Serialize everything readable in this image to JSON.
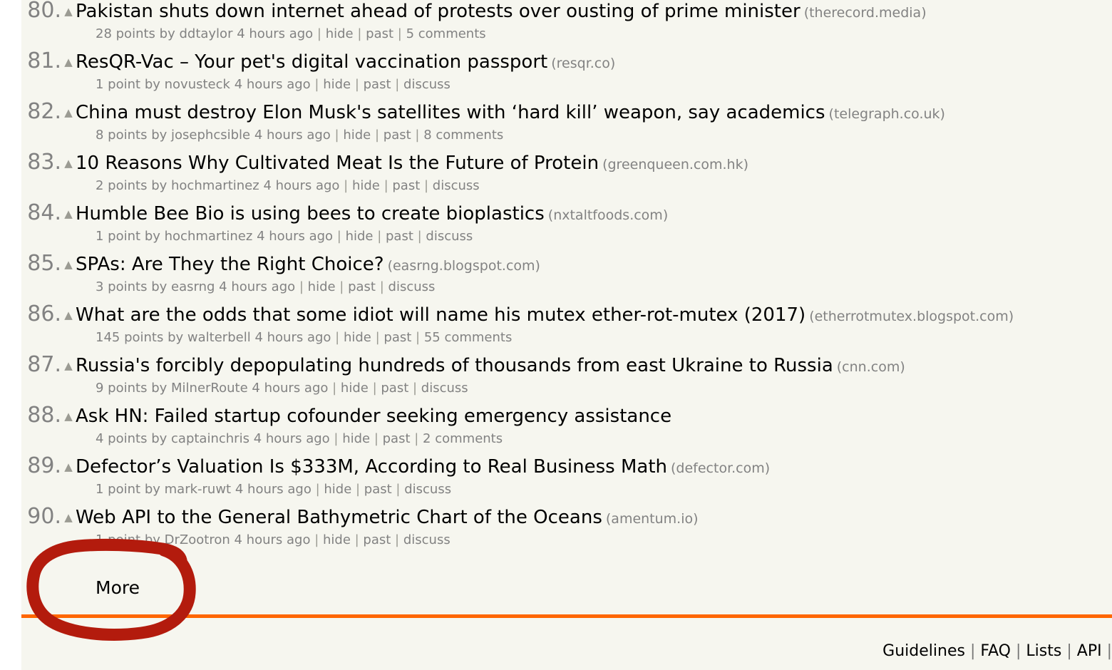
{
  "site": {
    "background": "#f6f6ef",
    "page_background": "#ffffff",
    "accent": "#ff6600",
    "muted_text": "#828282",
    "annotation_color": "#b31b0d"
  },
  "stories": [
    {
      "rank": "80.",
      "upvote_icon": "triangle-up-icon",
      "title": "Pakistan shuts down internet ahead of protests over ousting of prime minister",
      "site": "(therecord.media)",
      "points": "28 points",
      "by_label": "by",
      "author": "ddtaylor",
      "age": "4 hours ago",
      "hide": "hide",
      "past": "past",
      "comments": "5 comments"
    },
    {
      "rank": "81.",
      "upvote_icon": "triangle-up-icon",
      "title": "ResQR-Vac – Your pet's digital vaccination passport",
      "site": "(resqr.co)",
      "points": "1 point",
      "by_label": "by",
      "author": "novusteck",
      "age": "4 hours ago",
      "hide": "hide",
      "past": "past",
      "comments": "discuss"
    },
    {
      "rank": "82.",
      "upvote_icon": "triangle-up-icon",
      "title": "China must destroy Elon Musk's satellites with ‘hard kill’ weapon, say academics",
      "site": "(telegraph.co.uk)",
      "points": "8 points",
      "by_label": "by",
      "author": "josephcsible",
      "age": "4 hours ago",
      "hide": "hide",
      "past": "past",
      "comments": "8 comments"
    },
    {
      "rank": "83.",
      "upvote_icon": "triangle-up-icon",
      "title": "10 Reasons Why Cultivated Meat Is the Future of Protein",
      "site": "(greenqueen.com.hk)",
      "points": "2 points",
      "by_label": "by",
      "author": "hochmartinez",
      "age": "4 hours ago",
      "hide": "hide",
      "past": "past",
      "comments": "discuss"
    },
    {
      "rank": "84.",
      "upvote_icon": "triangle-up-icon",
      "title": "Humble Bee Bio is using bees to create bioplastics",
      "site": "(nxtaltfoods.com)",
      "points": "1 point",
      "by_label": "by",
      "author": "hochmartinez",
      "age": "4 hours ago",
      "hide": "hide",
      "past": "past",
      "comments": "discuss"
    },
    {
      "rank": "85.",
      "upvote_icon": "triangle-up-icon",
      "title": "SPAs: Are They the Right Choice?",
      "site": "(easrng.blogspot.com)",
      "points": "3 points",
      "by_label": "by",
      "author": "easrng",
      "age": "4 hours ago",
      "hide": "hide",
      "past": "past",
      "comments": "discuss"
    },
    {
      "rank": "86.",
      "upvote_icon": "triangle-up-icon",
      "title": "What are the odds that some idiot will name his mutex ether-rot-mutex (2017)",
      "site": "(etherrotmutex.blogspot.com)",
      "points": "145 points",
      "by_label": "by",
      "author": "walterbell",
      "age": "4 hours ago",
      "hide": "hide",
      "past": "past",
      "comments": "55 comments"
    },
    {
      "rank": "87.",
      "upvote_icon": "triangle-up-icon",
      "title": "Russia's forcibly depopulating hundreds of thousands from east Ukraine to Russia",
      "site": "(cnn.com)",
      "points": "9 points",
      "by_label": "by",
      "author": "MilnerRoute",
      "age": "4 hours ago",
      "hide": "hide",
      "past": "past",
      "comments": "discuss"
    },
    {
      "rank": "88.",
      "upvote_icon": "triangle-up-icon",
      "title": "Ask HN: Failed startup cofounder seeking emergency assistance",
      "site": "",
      "points": "4 points",
      "by_label": "by",
      "author": "captainchris",
      "age": "4 hours ago",
      "hide": "hide",
      "past": "past",
      "comments": "2 comments"
    },
    {
      "rank": "89.",
      "upvote_icon": "triangle-up-icon",
      "title": "Defector’s Valuation Is $333M, According to Real Business Math",
      "site": "(defector.com)",
      "points": "1 point",
      "by_label": "by",
      "author": "mark-ruwt",
      "age": "4 hours ago",
      "hide": "hide",
      "past": "past",
      "comments": "discuss"
    },
    {
      "rank": "90.",
      "upvote_icon": "triangle-up-icon",
      "title": "Web API to the General Bathymetric Chart of the Oceans",
      "site": "(amentum.io)",
      "points": "1 point",
      "by_label": "by",
      "author": "DrZootron",
      "age": "4 hours ago",
      "hide": "hide",
      "past": "past",
      "comments": "discuss"
    }
  ],
  "more": {
    "label": "More"
  },
  "footer": {
    "links": [
      "Guidelines",
      "FAQ",
      "Lists",
      "API"
    ],
    "separator": "|",
    "trailing_separator": "|"
  },
  "annotation": {
    "shape": "hand-drawn-ellipse",
    "target": "More"
  }
}
